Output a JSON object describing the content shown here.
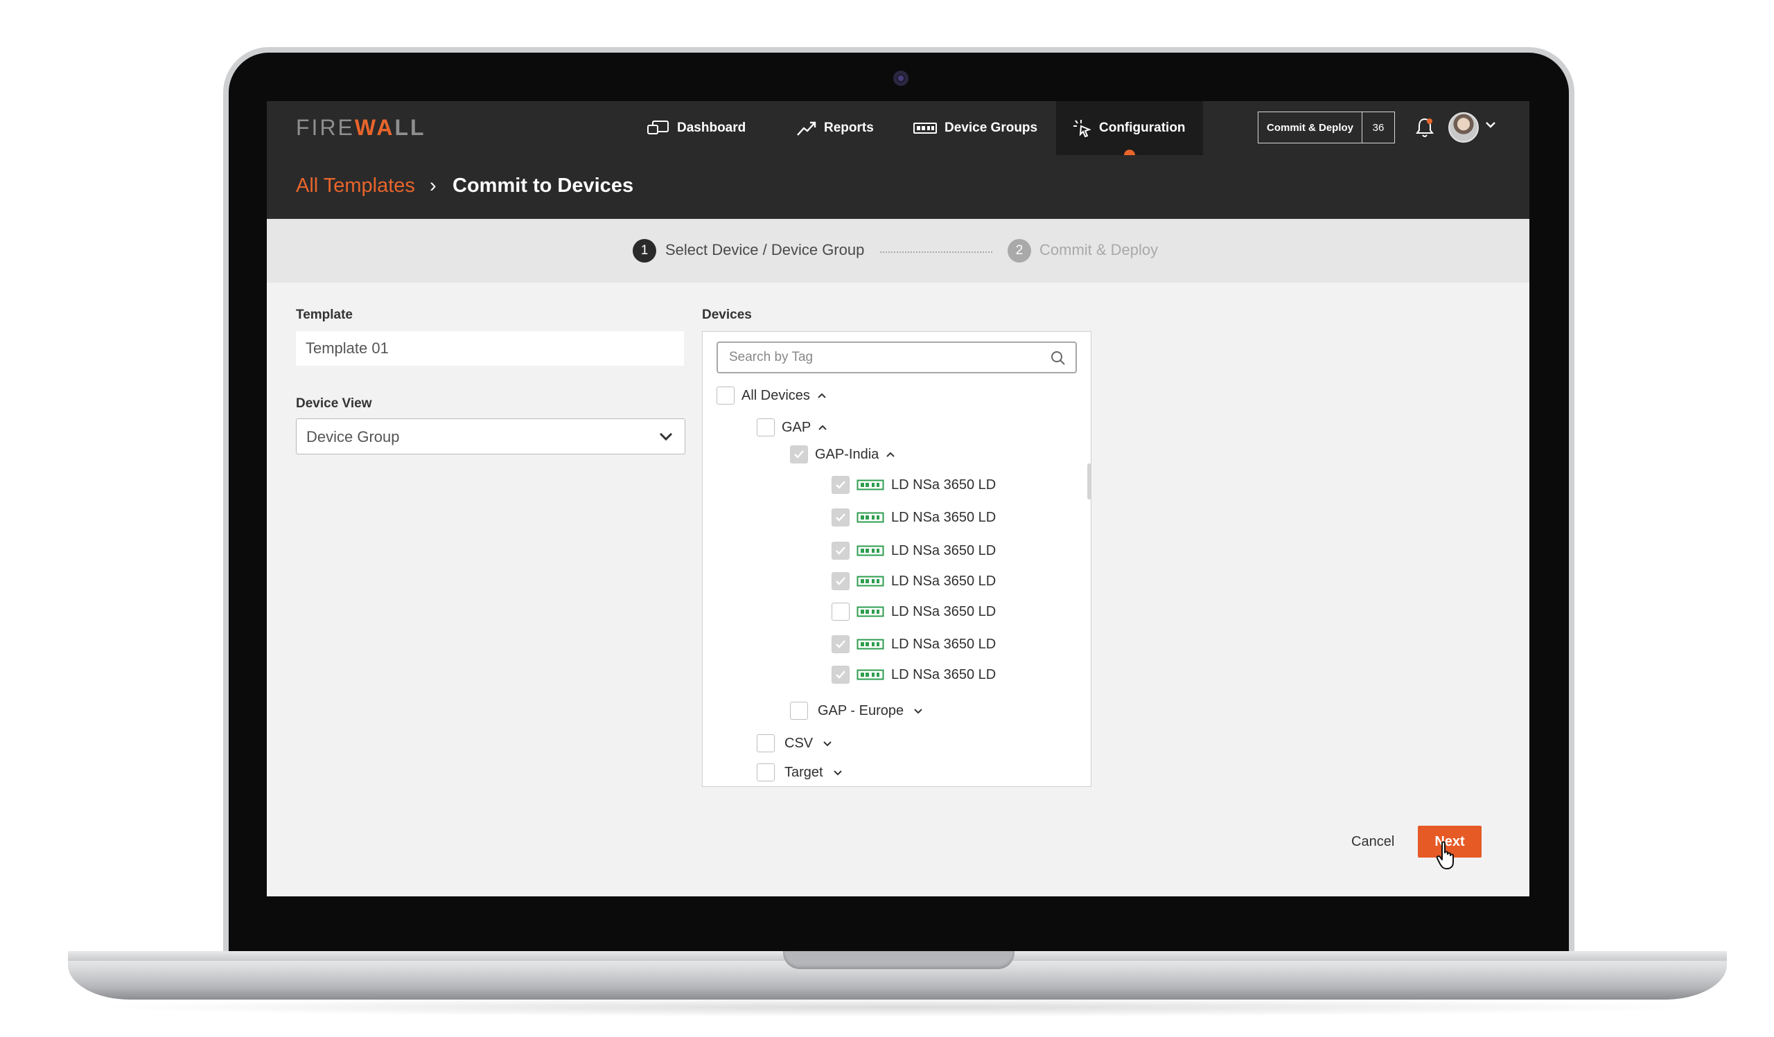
{
  "app": {
    "logo_prefix": "FIRE",
    "logo_mid": "WA",
    "logo_suffix": "LL"
  },
  "nav": {
    "items": [
      {
        "label": "Dashboard",
        "icon": "dashboard-icon"
      },
      {
        "label": "Reports",
        "icon": "reports-trend-icon"
      },
      {
        "label": "Device Groups",
        "icon": "device-groups-icon"
      },
      {
        "label": "Configuration",
        "icon": "configuration-cursor-icon",
        "active": true
      }
    ],
    "commit_deploy_label": "Commit & Deploy",
    "commit_deploy_count": "36"
  },
  "breadcrumb": {
    "parent": "All Templates",
    "separator": "›",
    "current": "Commit to Devices"
  },
  "steps": [
    {
      "number": "1",
      "label": "Select Device / Device Group",
      "state": "active"
    },
    {
      "number": "2",
      "label": "Commit & Deploy",
      "state": "inactive"
    }
  ],
  "form": {
    "template_label": "Template",
    "template_value": "Template 01",
    "device_view_label": "Device View",
    "device_view_value": "Device Group",
    "devices_label": "Devices",
    "search_placeholder": "Search by Tag"
  },
  "tree": {
    "all_devices": {
      "label": "All Devices",
      "checked": false,
      "expanded": true
    },
    "gap": {
      "label": "GAP",
      "checked": false,
      "expanded": true
    },
    "gap_india": {
      "label": "GAP-India",
      "checked": true,
      "expanded": true
    },
    "devices": [
      {
        "label": "LD NSa 3650 LD",
        "checked": true
      },
      {
        "label": "LD NSa 3650 LD",
        "checked": true
      },
      {
        "label": "LD NSa 3650 LD",
        "checked": true
      },
      {
        "label": "LD NSa 3650 LD",
        "checked": true
      },
      {
        "label": "LD NSa 3650 LD",
        "checked": false
      },
      {
        "label": "LD NSa 3650 LD",
        "checked": true
      },
      {
        "label": "LD NSa 3650 LD",
        "checked": true
      }
    ],
    "gap_europe": {
      "label": "GAP - Europe",
      "checked": false,
      "expanded": false
    },
    "csv": {
      "label": "CSV",
      "checked": false,
      "expanded": false
    },
    "target": {
      "label": "Target",
      "checked": false,
      "expanded": false
    }
  },
  "actions": {
    "cancel_label": "Cancel",
    "next_label": "Next"
  },
  "colors": {
    "accent": "#e8652c",
    "topbar": "#2a2a2a",
    "device_icon": "#2e9e4f"
  }
}
